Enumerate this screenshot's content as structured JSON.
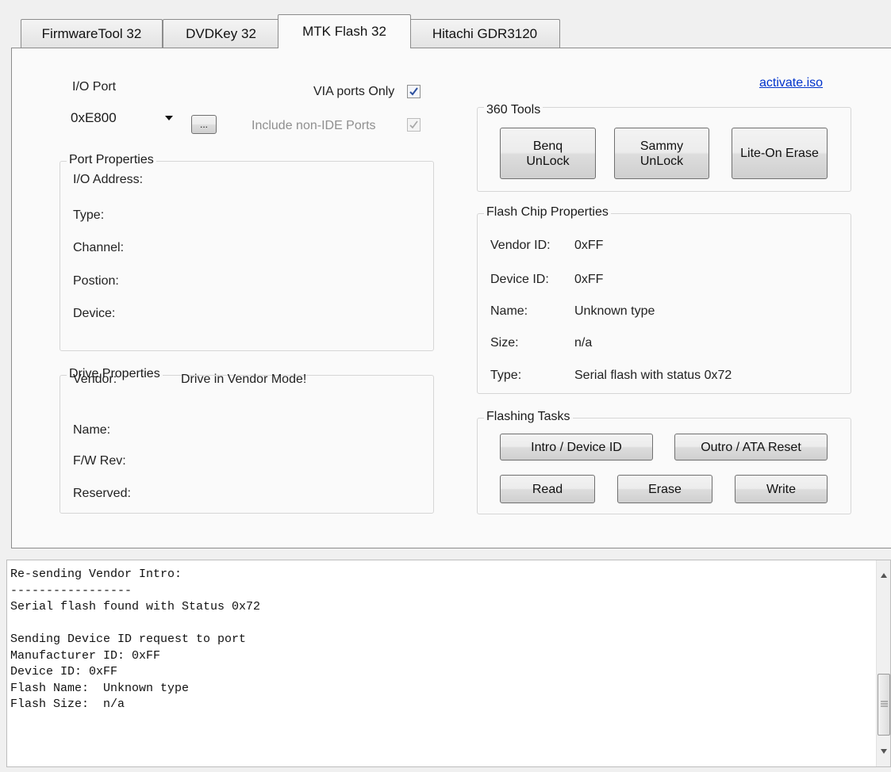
{
  "tabs": [
    {
      "label": "FirmwareTool 32"
    },
    {
      "label": "DVDKey 32"
    },
    {
      "label": "MTK Flash 32"
    },
    {
      "label": "Hitachi GDR3120"
    }
  ],
  "io_port": {
    "label": "I/O Port",
    "value": "0xE800",
    "browse_label": "...",
    "via_only_label": "VIA ports Only",
    "via_only_checked": true,
    "include_non_ide_label": "Include non-IDE Ports",
    "include_non_ide_checked": true
  },
  "port_properties": {
    "title": "Port Properties",
    "io_address": "I/O Address:",
    "type": "Type:",
    "channel": "Channel:",
    "position": "Postion:",
    "device": "Device:"
  },
  "drive_properties": {
    "title": "Drive Properties",
    "vendor_label": "Vendor:",
    "vendor_value": "Drive in Vendor Mode!",
    "name_label": "Name:",
    "fw_label": "F/W Rev:",
    "reserved_label": "Reserved:"
  },
  "activate_link": "activate.iso",
  "tools_360": {
    "title": "360 Tools",
    "benq_label": "Benq UnLock",
    "sammy_label": "Sammy UnLock",
    "liteon_label": "Lite-On Erase"
  },
  "flash_chip": {
    "title": "Flash Chip Properties",
    "vendor_id_label": "Vendor ID:",
    "vendor_id_value": "0xFF",
    "device_id_label": "Device ID:",
    "device_id_value": "0xFF",
    "name_label": "Name:",
    "name_value": "Unknown type",
    "size_label": "Size:",
    "size_value": "n/a",
    "type_label": "Type:",
    "type_value": "Serial flash with status 0x72"
  },
  "flashing_tasks": {
    "title": "Flashing Tasks",
    "intro_label": "Intro / Device ID",
    "outro_label": "Outro / ATA Reset",
    "read_label": "Read",
    "erase_label": "Erase",
    "write_label": "Write"
  },
  "log": {
    "text": "Re-sending Vendor Intro:\n-----------------\nSerial flash found with Status 0x72\n\nSending Device ID request to port\nManufacturer ID: 0xFF\nDevice ID: 0xFF\nFlash Name:  Unknown type\nFlash Size:  n/a"
  },
  "icons": {
    "dropdown": "chevron-down-icon",
    "checkmark": "checkmark-icon",
    "scroll_up": "scroll-up-icon",
    "scroll_down": "scroll-down-icon",
    "scroll_grip": "scroll-grip-icon"
  },
  "colors": {
    "link": "#0033cc",
    "checkmark": "#2b4f9e",
    "panel": "#fafafa",
    "window": "#f0f0f0"
  }
}
